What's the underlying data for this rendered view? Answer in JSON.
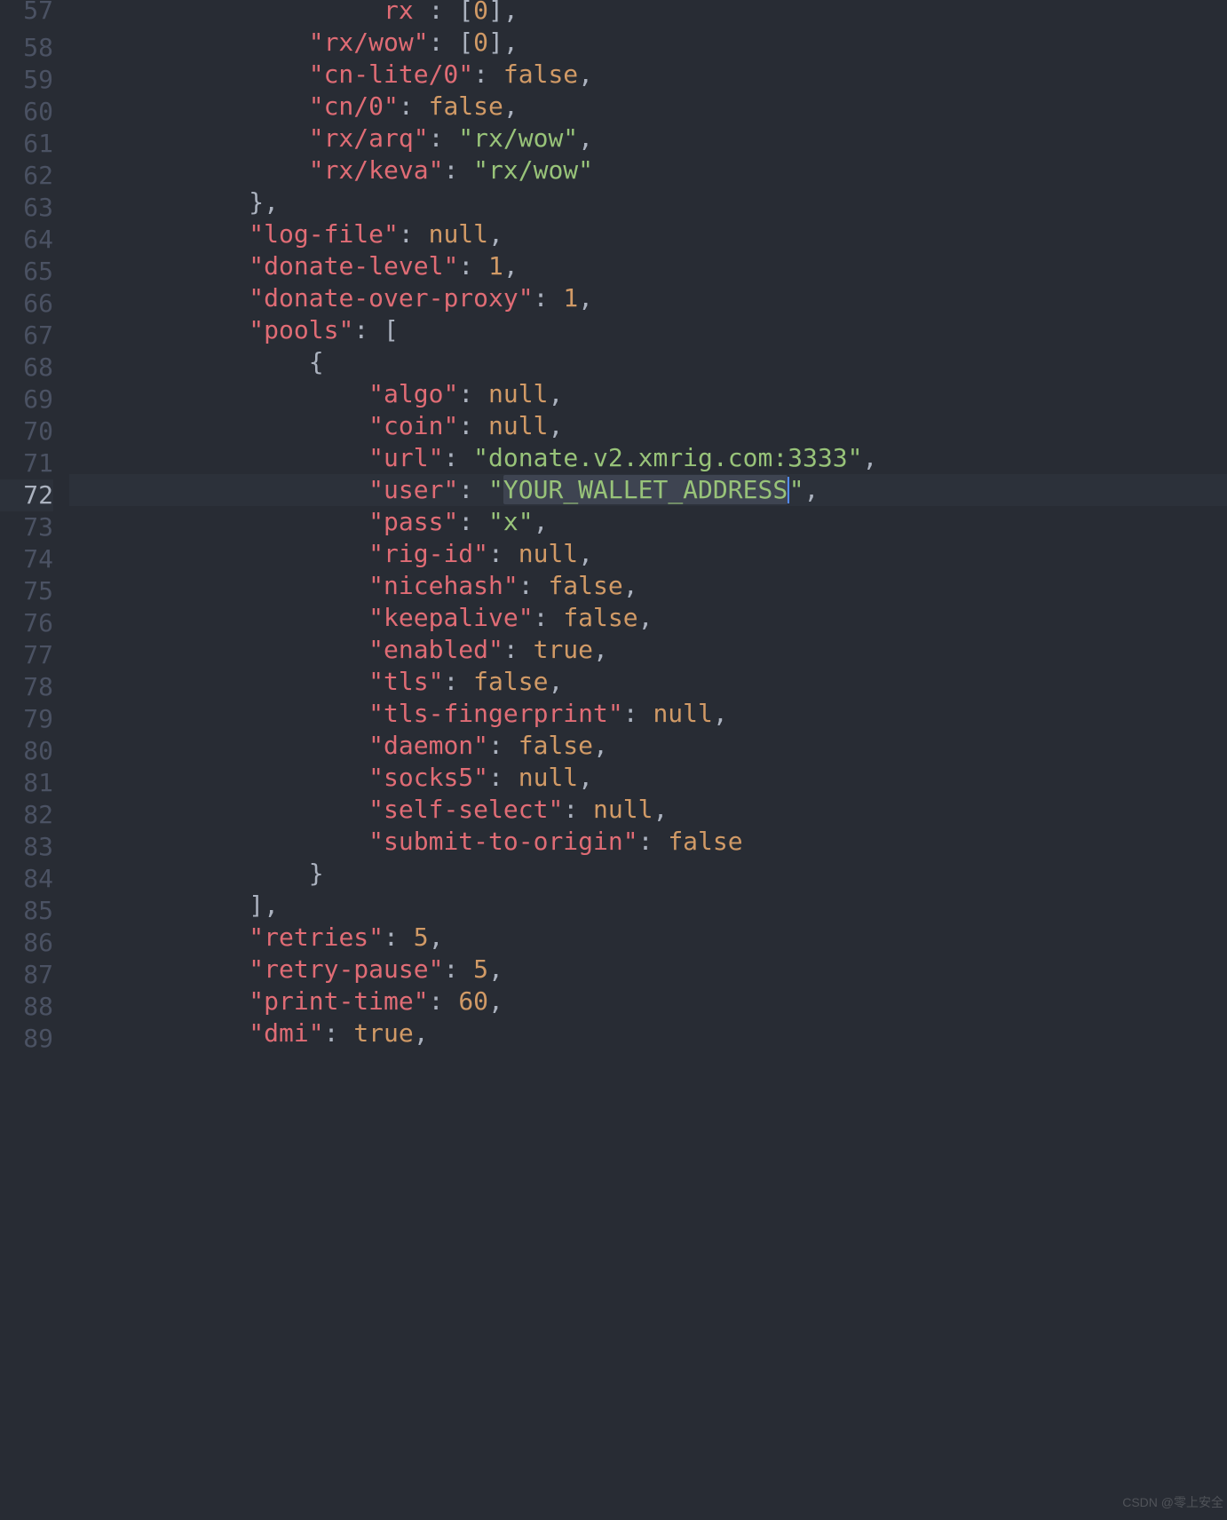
{
  "lines": [
    {
      "num": 57,
      "indent": 5,
      "tokens": [
        [
          "p",
          " "
        ],
        [
          "k",
          "rx"
        ],
        [
          "p",
          " : ["
        ],
        [
          "n",
          "0"
        ],
        [
          "p",
          "],"
        ]
      ],
      "cropped": true
    },
    {
      "num": 58,
      "indent": 4,
      "tokens": [
        [
          "k",
          "\"rx/wow\""
        ],
        [
          "p",
          ": ["
        ],
        [
          "n",
          "0"
        ],
        [
          "p",
          "],"
        ]
      ]
    },
    {
      "num": 59,
      "indent": 4,
      "tokens": [
        [
          "k",
          "\"cn-lite/0\""
        ],
        [
          "p",
          ": "
        ],
        [
          "n",
          "false"
        ],
        [
          "p",
          ","
        ]
      ]
    },
    {
      "num": 60,
      "indent": 4,
      "tokens": [
        [
          "k",
          "\"cn/0\""
        ],
        [
          "p",
          ": "
        ],
        [
          "n",
          "false"
        ],
        [
          "p",
          ","
        ]
      ]
    },
    {
      "num": 61,
      "indent": 4,
      "tokens": [
        [
          "k",
          "\"rx/arq\""
        ],
        [
          "p",
          ": "
        ],
        [
          "s",
          "\"rx/wow\""
        ],
        [
          "p",
          ","
        ]
      ]
    },
    {
      "num": 62,
      "indent": 4,
      "tokens": [
        [
          "k",
          "\"rx/keva\""
        ],
        [
          "p",
          ": "
        ],
        [
          "s",
          "\"rx/wow\""
        ]
      ]
    },
    {
      "num": 63,
      "indent": 3,
      "tokens": [
        [
          "p",
          "},"
        ]
      ]
    },
    {
      "num": 64,
      "indent": 3,
      "tokens": [
        [
          "k",
          "\"log-file\""
        ],
        [
          "p",
          ": "
        ],
        [
          "n",
          "null"
        ],
        [
          "p",
          ","
        ]
      ]
    },
    {
      "num": 65,
      "indent": 3,
      "tokens": [
        [
          "k",
          "\"donate-level\""
        ],
        [
          "p",
          ": "
        ],
        [
          "n",
          "1"
        ],
        [
          "p",
          ","
        ]
      ]
    },
    {
      "num": 66,
      "indent": 3,
      "tokens": [
        [
          "k",
          "\"donate-over-proxy\""
        ],
        [
          "p",
          ": "
        ],
        [
          "n",
          "1"
        ],
        [
          "p",
          ","
        ]
      ]
    },
    {
      "num": 67,
      "indent": 3,
      "tokens": [
        [
          "k",
          "\"pools\""
        ],
        [
          "p",
          ": ["
        ]
      ]
    },
    {
      "num": 68,
      "indent": 4,
      "tokens": [
        [
          "p",
          "{"
        ]
      ]
    },
    {
      "num": 69,
      "indent": 5,
      "tokens": [
        [
          "k",
          "\"algo\""
        ],
        [
          "p",
          ": "
        ],
        [
          "n",
          "null"
        ],
        [
          "p",
          ","
        ]
      ]
    },
    {
      "num": 70,
      "indent": 5,
      "tokens": [
        [
          "k",
          "\"coin\""
        ],
        [
          "p",
          ": "
        ],
        [
          "n",
          "null"
        ],
        [
          "p",
          ","
        ]
      ]
    },
    {
      "num": 71,
      "indent": 5,
      "tokens": [
        [
          "k",
          "\"url\""
        ],
        [
          "p",
          ": "
        ],
        [
          "s",
          "\"donate.v2.xmrig.com:3333\""
        ],
        [
          "p",
          ","
        ]
      ]
    },
    {
      "num": 72,
      "indent": 5,
      "tokens": [
        [
          "k",
          "\"user\""
        ],
        [
          "p",
          ": "
        ],
        [
          "s",
          "\""
        ],
        [
          "sel",
          "YOUR_WALLET_ADDRESS"
        ],
        [
          "cur",
          ""
        ],
        [
          "s",
          "\""
        ],
        [
          "p",
          ","
        ]
      ],
      "active": true
    },
    {
      "num": 73,
      "indent": 5,
      "tokens": [
        [
          "k",
          "\"pass\""
        ],
        [
          "p",
          ": "
        ],
        [
          "s",
          "\"x\""
        ],
        [
          "p",
          ","
        ]
      ]
    },
    {
      "num": 74,
      "indent": 5,
      "tokens": [
        [
          "k",
          "\"rig-id\""
        ],
        [
          "p",
          ": "
        ],
        [
          "n",
          "null"
        ],
        [
          "p",
          ","
        ]
      ]
    },
    {
      "num": 75,
      "indent": 5,
      "tokens": [
        [
          "k",
          "\"nicehash\""
        ],
        [
          "p",
          ": "
        ],
        [
          "n",
          "false"
        ],
        [
          "p",
          ","
        ]
      ]
    },
    {
      "num": 76,
      "indent": 5,
      "tokens": [
        [
          "k",
          "\"keepalive\""
        ],
        [
          "p",
          ": "
        ],
        [
          "n",
          "false"
        ],
        [
          "p",
          ","
        ]
      ]
    },
    {
      "num": 77,
      "indent": 5,
      "tokens": [
        [
          "k",
          "\"enabled\""
        ],
        [
          "p",
          ": "
        ],
        [
          "n",
          "true"
        ],
        [
          "p",
          ","
        ]
      ]
    },
    {
      "num": 78,
      "indent": 5,
      "tokens": [
        [
          "k",
          "\"tls\""
        ],
        [
          "p",
          ": "
        ],
        [
          "n",
          "false"
        ],
        [
          "p",
          ","
        ]
      ]
    },
    {
      "num": 79,
      "indent": 5,
      "tokens": [
        [
          "k",
          "\"tls-fingerprint\""
        ],
        [
          "p",
          ": "
        ],
        [
          "n",
          "null"
        ],
        [
          "p",
          ","
        ]
      ]
    },
    {
      "num": 80,
      "indent": 5,
      "tokens": [
        [
          "k",
          "\"daemon\""
        ],
        [
          "p",
          ": "
        ],
        [
          "n",
          "false"
        ],
        [
          "p",
          ","
        ]
      ]
    },
    {
      "num": 81,
      "indent": 5,
      "tokens": [
        [
          "k",
          "\"socks5\""
        ],
        [
          "p",
          ": "
        ],
        [
          "n",
          "null"
        ],
        [
          "p",
          ","
        ]
      ]
    },
    {
      "num": 82,
      "indent": 5,
      "tokens": [
        [
          "k",
          "\"self-select\""
        ],
        [
          "p",
          ": "
        ],
        [
          "n",
          "null"
        ],
        [
          "p",
          ","
        ]
      ]
    },
    {
      "num": 83,
      "indent": 5,
      "tokens": [
        [
          "k",
          "\"submit-to-origin\""
        ],
        [
          "p",
          ": "
        ],
        [
          "n",
          "false"
        ]
      ]
    },
    {
      "num": 84,
      "indent": 4,
      "tokens": [
        [
          "p",
          "}"
        ]
      ]
    },
    {
      "num": 85,
      "indent": 3,
      "tokens": [
        [
          "p",
          "],"
        ]
      ]
    },
    {
      "num": 86,
      "indent": 3,
      "tokens": [
        [
          "k",
          "\"retries\""
        ],
        [
          "p",
          ": "
        ],
        [
          "n",
          "5"
        ],
        [
          "p",
          ","
        ]
      ]
    },
    {
      "num": 87,
      "indent": 3,
      "tokens": [
        [
          "k",
          "\"retry-pause\""
        ],
        [
          "p",
          ": "
        ],
        [
          "n",
          "5"
        ],
        [
          "p",
          ","
        ]
      ]
    },
    {
      "num": 88,
      "indent": 3,
      "tokens": [
        [
          "k",
          "\"print-time\""
        ],
        [
          "p",
          ": "
        ],
        [
          "n",
          "60"
        ],
        [
          "p",
          ","
        ]
      ]
    },
    {
      "num": 89,
      "indent": 3,
      "tokens": [
        [
          "k",
          "\"dmi\""
        ],
        [
          "p",
          ": "
        ],
        [
          "n",
          "true"
        ],
        [
          "p",
          ","
        ]
      ]
    }
  ],
  "watermark": "CSDN @零上安全"
}
